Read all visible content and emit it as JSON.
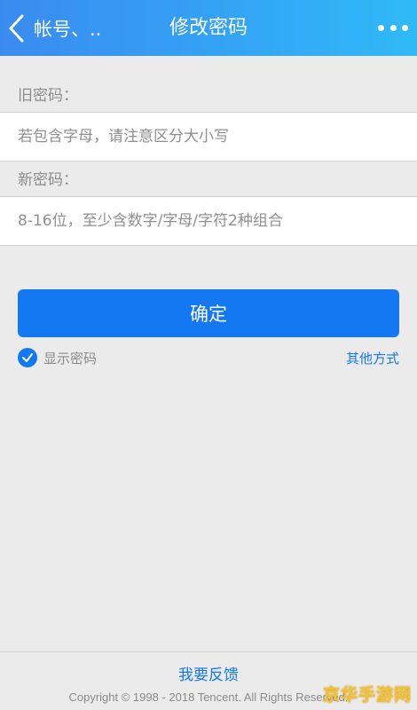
{
  "header": {
    "back_label": "帐号、..",
    "title": "修改密码",
    "back_icon": "chevron-left-icon",
    "more_icon": "more-dots-icon"
  },
  "form": {
    "old_password_label": "旧密码：",
    "old_password_placeholder": "若包含字母，请注意区分大小写",
    "old_password_value": "",
    "new_password_label": "新密码：",
    "new_password_placeholder": "8-16位，至少含数字/字母/字符2种组合",
    "new_password_value": "",
    "confirm_label": "确定",
    "show_password_label": "显示密码",
    "show_password_checked": true,
    "other_methods_label": "其他方式"
  },
  "footer": {
    "feedback_label": "我要反馈",
    "copyright": "Copyright © 1998 - 2018 Tencent. All Rights Reserved."
  },
  "watermark": "京华手游网",
  "colors": {
    "header_gradient_start": "#3a8bf0",
    "header_gradient_end": "#2fbaf7",
    "accent": "#1378f2",
    "background": "#ebebeb",
    "watermark": "#f3c234"
  }
}
